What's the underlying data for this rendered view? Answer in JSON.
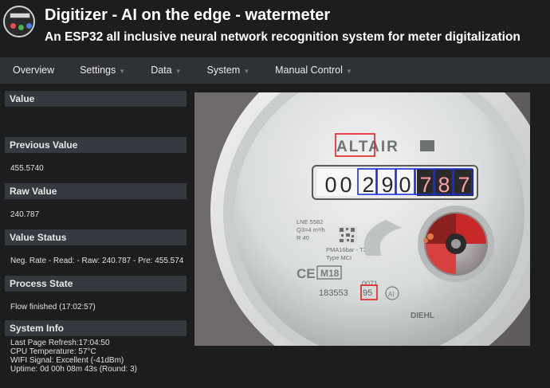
{
  "header": {
    "title": "Digitizer - AI on the edge - watermeter",
    "subtitle": "An ESP32 all inclusive neural network recognition system for meter digitalization"
  },
  "nav": {
    "items": [
      {
        "label": "Overview"
      },
      {
        "label": "Settings"
      },
      {
        "label": "Data"
      },
      {
        "label": "System"
      },
      {
        "label": "Manual Control"
      }
    ]
  },
  "sections": {
    "value": {
      "title": "Value",
      "text": ""
    },
    "previous_value": {
      "title": "Previous Value",
      "text": "455.5740"
    },
    "raw_value": {
      "title": "Raw Value",
      "text": "240.787"
    },
    "value_status": {
      "title": "Value Status",
      "text": "Neg. Rate - Read: - Raw: 240.787 - Pre: 455.574"
    },
    "process_state": {
      "title": "Process State",
      "text": "Flow finished (17:02:57)"
    },
    "system_info": {
      "title": "System Info",
      "lines": [
        "Last Page Refresh:17:04:50",
        "CPU Temperature: 57°C",
        "WIFI Signal: Excellent (-41dBm)",
        "Uptime: 0d 00h 08m 43s (Round: 3)"
      ]
    }
  },
  "meter_image": {
    "brand": "ALTAIR",
    "digits": [
      "0",
      "0",
      "2",
      "9",
      "0",
      "7",
      "8",
      "7"
    ],
    "print_code": "LNE 5582",
    "flow_label": "Q3=4 m³/h",
    "r_label": "R 40",
    "model": "PMA16bar - T30",
    "type": "Type MCI",
    "ce_mark": "CE",
    "m18": "M18",
    "code_0071": "0071",
    "serial_prefix": "183553",
    "serial_suffix": "95",
    "circle_mark": "AI",
    "maker": "DIEHL",
    "colors": {
      "roi_red": "#e02020",
      "roi_blue": "#1c2fd8"
    }
  }
}
